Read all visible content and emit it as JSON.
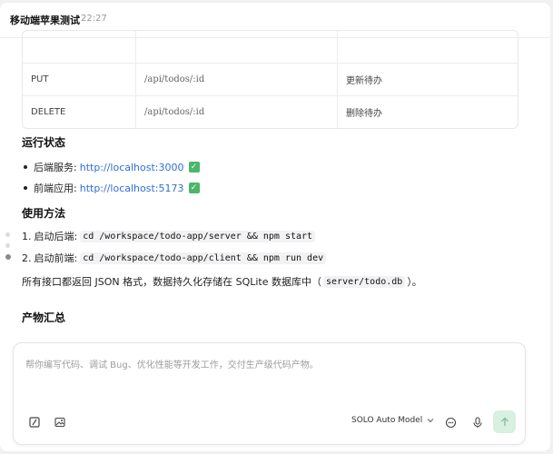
{
  "header": {
    "title": "移动端苹果测试",
    "time": "22:27"
  },
  "api_table": {
    "rows": [
      {
        "method": "",
        "path": "",
        "desc": ""
      },
      {
        "method": "PUT",
        "path": "/api/todos/:id",
        "desc": "更新待办"
      },
      {
        "method": "DELETE",
        "path": "/api/todos/:id",
        "desc": "删除待办"
      }
    ]
  },
  "status": {
    "heading": "运行状态",
    "items": [
      {
        "label": "后端服务:",
        "url": "http://localhost:3000"
      },
      {
        "label": "前端应用:",
        "url": "http://localhost:5173"
      }
    ]
  },
  "usage": {
    "heading": "使用方法",
    "steps": [
      {
        "num": "1.",
        "label": "启动后端:",
        "cmd": "cd /workspace/todo-app/server && npm start"
      },
      {
        "num": "2.",
        "label": "启动前端:",
        "cmd": "cd /workspace/todo-app/client && npm run dev"
      }
    ]
  },
  "note": {
    "before": "所有接口都返回 JSON 格式，数据持久化存储在 SQLite 数据库中（",
    "code": "server/todo.db",
    "after": "）。"
  },
  "artifacts": {
    "heading": "产物汇总"
  },
  "composer": {
    "placeholder": "帮你编写代码、调试 Bug、优化性能等开发工作，交付生产级代码产物。",
    "model_label": "SOLO Auto Model"
  },
  "colors": {
    "link": "#2f6fd6",
    "check": "#4cb66a",
    "send_bg": "#d9efe1"
  }
}
